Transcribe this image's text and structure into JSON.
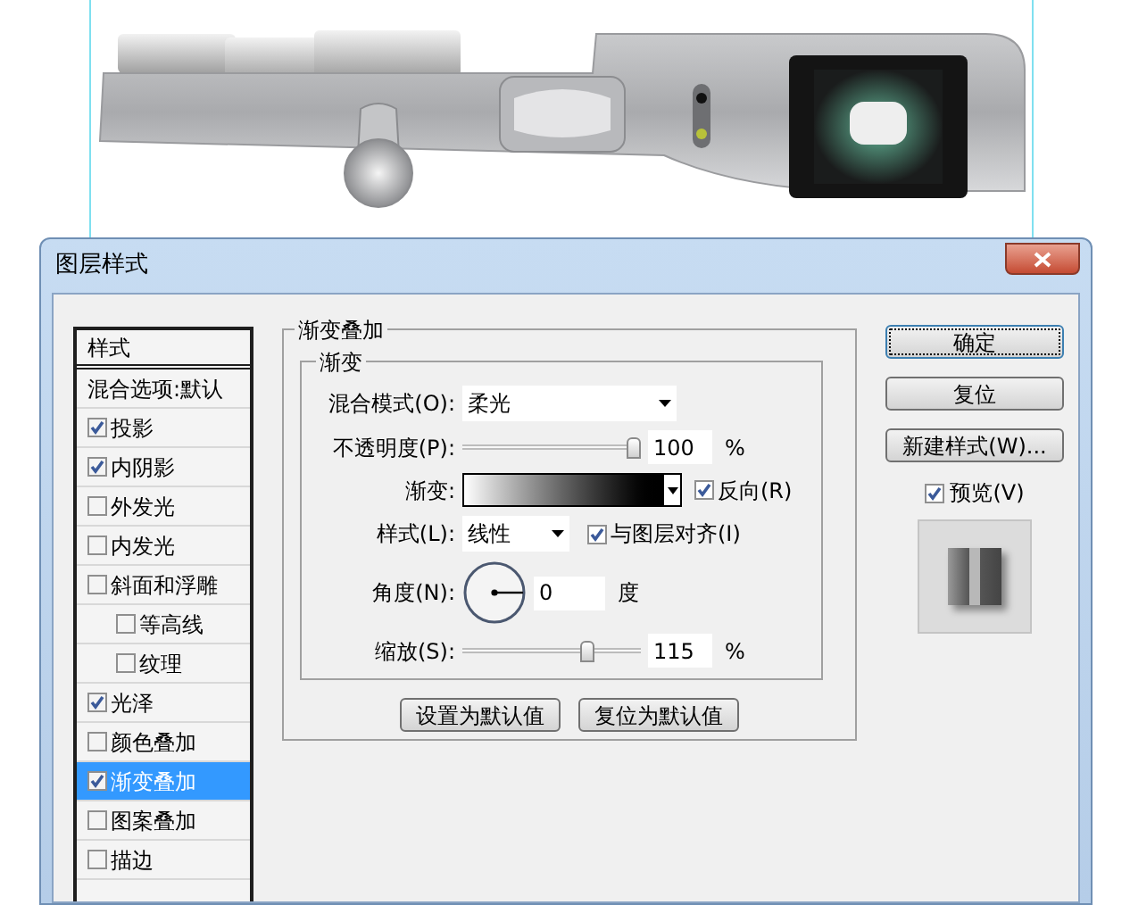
{
  "window": {
    "title": "图层样式"
  },
  "styles_panel": {
    "header": "样式",
    "blend_options": "混合选项:默认",
    "items": [
      {
        "label": "投影",
        "checked": true,
        "selected": false
      },
      {
        "label": "内阴影",
        "checked": true,
        "selected": false
      },
      {
        "label": "外发光",
        "checked": false,
        "selected": false
      },
      {
        "label": "内发光",
        "checked": false,
        "selected": false
      },
      {
        "label": "斜面和浮雕",
        "checked": false,
        "selected": false,
        "children": [
          {
            "label": "等高线",
            "checked": false,
            "selected": false
          },
          {
            "label": "纹理",
            "checked": false,
            "selected": false
          }
        ]
      },
      {
        "label": "光泽",
        "checked": true,
        "selected": false
      },
      {
        "label": "颜色叠加",
        "checked": false,
        "selected": false
      },
      {
        "label": "渐变叠加",
        "checked": true,
        "selected": true
      },
      {
        "label": "图案叠加",
        "checked": false,
        "selected": false
      },
      {
        "label": "描边",
        "checked": false,
        "selected": false
      }
    ]
  },
  "section": {
    "title": "渐变叠加",
    "group_title": "渐变",
    "blend_mode": {
      "label": "混合模式(O):",
      "value": "柔光"
    },
    "opacity": {
      "label": "不透明度(P):",
      "level": 1.0,
      "value": "100",
      "unit": "%"
    },
    "gradient": {
      "label": "渐变:",
      "reverse": {
        "label": "反向(R)",
        "checked": true
      }
    },
    "style": {
      "label": "样式(L):",
      "value": "线性",
      "align": {
        "label": "与图层对齐(I)",
        "checked": true
      }
    },
    "angle": {
      "label": "角度(N):",
      "value": "0",
      "unit": "度"
    },
    "scale": {
      "label": "缩放(S):",
      "level": 0.72,
      "value": "115",
      "unit": "%"
    },
    "buttons": [
      "设置为默认值",
      "复位为默认值"
    ]
  },
  "actions": {
    "buttons": [
      {
        "label": "确定",
        "selected": true
      },
      {
        "label": "复位",
        "selected": false
      },
      {
        "label": "新建样式(W)...",
        "selected": false
      }
    ],
    "preview": {
      "label": "预览(V)",
      "checked": true
    }
  }
}
